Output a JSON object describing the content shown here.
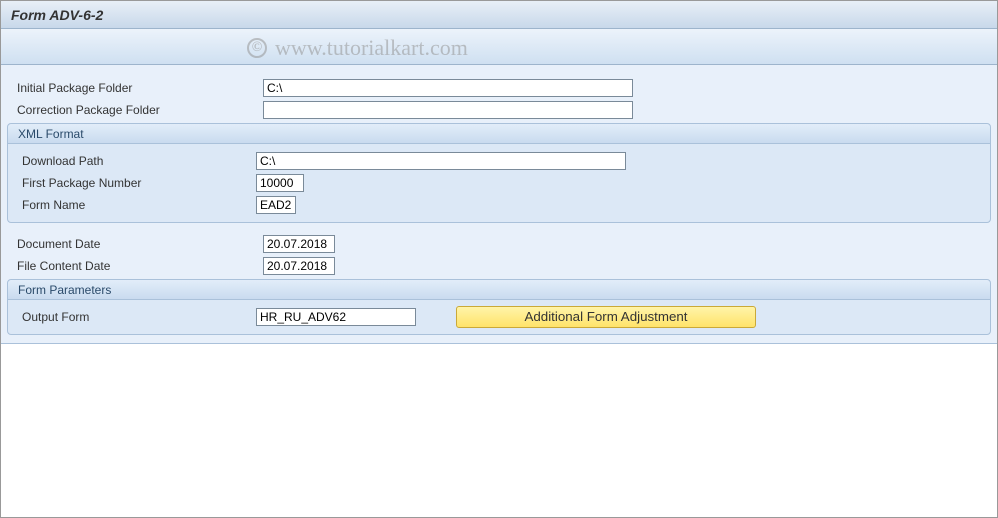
{
  "header": {
    "title": "Form ADV-6-2"
  },
  "watermark": {
    "symbol": "©",
    "text": "www.tutorialkart.com"
  },
  "top": {
    "initial_pkg_label": "Initial Package Folder",
    "initial_pkg_value": "C:\\",
    "correction_pkg_label": "Correction Package Folder",
    "correction_pkg_value": ""
  },
  "xml": {
    "group_title": "XML Format",
    "download_label": "Download Path",
    "download_value": "C:\\",
    "first_pkg_label": "First Package Number",
    "first_pkg_value": "10000",
    "form_name_label": "Form Name",
    "form_name_value": "EAD2"
  },
  "dates": {
    "doc_date_label": "Document Date",
    "doc_date_value": "20.07.2018",
    "file_date_label": "File Content Date",
    "file_date_value": "20.07.2018"
  },
  "params": {
    "group_title": "Form Parameters",
    "output_form_label": "Output Form",
    "output_form_value": "HR_RU_ADV62",
    "button_label": "Additional Form Adjustment"
  }
}
